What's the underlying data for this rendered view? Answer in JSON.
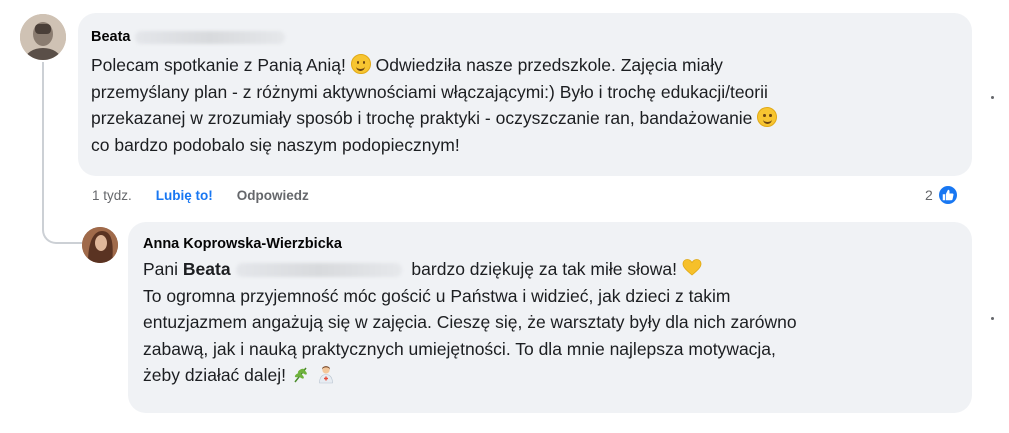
{
  "comment": {
    "author_first": "Beata",
    "text_line1": "Polecam spotkanie z Panią Anią!",
    "text_line1b": " Odwiedziła nasze przedszkole. Zajęcia miały",
    "text_line2": "przemyślany plan - z różnymi aktywnościami włączającymi:) Było i trochę edukacji/teorii",
    "text_line3": "przekazanej w zrozumiały sposób i trochę praktyki - oczyszczanie ran, bandażowanie",
    "text_line4": "co bardzo podobalo się naszym podopiecznym!",
    "time": "1 tydz.",
    "like_label": "Lubię to!",
    "reply_label": "Odpowiedz",
    "reaction_count": "2"
  },
  "reply": {
    "author": "Anna Koprowska-Wierzbicka",
    "line1_pre": "Pani ",
    "line1_bold": "Beata",
    "line1_post": " bardzo dziękuję za tak miłe słowa!",
    "line2": "To ogromna przyjemność móc gościć u Państwa i widzieć, jak dzieci z takim",
    "line3": "entuzjazmem angażują się w zajęcia. Cieszę się, że warsztaty były dla nich zarówno",
    "line4": "zabawą, jak i nauką praktycznych umiejętności. To dla mnie najlepsza motywacja,",
    "line5": "żeby działać dalej!"
  },
  "icons": {
    "like": "like-thumb-icon",
    "smile": "smiling-face-emoji",
    "heart": "yellow-heart-emoji",
    "herb": "herb-emoji",
    "health_worker": "health-worker-emoji"
  },
  "colors": {
    "bubble": "#f0f2f5",
    "accent": "#1877f2",
    "secondary_text": "#65676b"
  }
}
